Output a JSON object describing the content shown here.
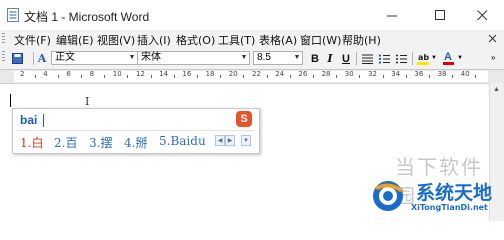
{
  "window": {
    "title": "文档 1 - Microsoft Word",
    "minimize_icon": "minimize-icon",
    "maximize_icon": "maximize-icon",
    "close_icon": "close-icon"
  },
  "menubar": {
    "items": [
      {
        "label": "文件(F)"
      },
      {
        "label": "编辑(E)"
      },
      {
        "label": "视图(V)"
      },
      {
        "label": "插入(I)"
      },
      {
        "label": "格式(O)"
      },
      {
        "label": "工具(T)"
      },
      {
        "label": "表格(A)"
      },
      {
        "label": "窗口(W)"
      },
      {
        "label": "帮助(H)"
      }
    ]
  },
  "toolbar": {
    "style_value": "正文",
    "font_value": "宋体",
    "size_value": "8.5",
    "bold_label": "B",
    "italic_label": "I",
    "underline_label": "U",
    "font_color_label": "A",
    "highlight_color": "#ffe600",
    "font_color": "#e00000"
  },
  "ruler": {
    "labels": [
      "2",
      "4",
      "6",
      "8",
      "10",
      "12",
      "14",
      "16",
      "18",
      "20",
      "22",
      "24",
      "26",
      "28",
      "30",
      "32",
      "34",
      "36",
      "38",
      "40"
    ]
  },
  "ime": {
    "input": "bai",
    "candidates": [
      {
        "label": "1.白"
      },
      {
        "label": "2.百"
      },
      {
        "label": "3.摆"
      },
      {
        "label": "4.掰"
      },
      {
        "label": "5.Baidu"
      }
    ],
    "logo_letter": "S",
    "first_candidate_color": "#d63b1e",
    "candidate_color": "#2a6cc6"
  },
  "watermarks": {
    "site1": "当下软件园",
    "site2": "系统天地",
    "site2_url": "XiTongTianDi.net"
  }
}
